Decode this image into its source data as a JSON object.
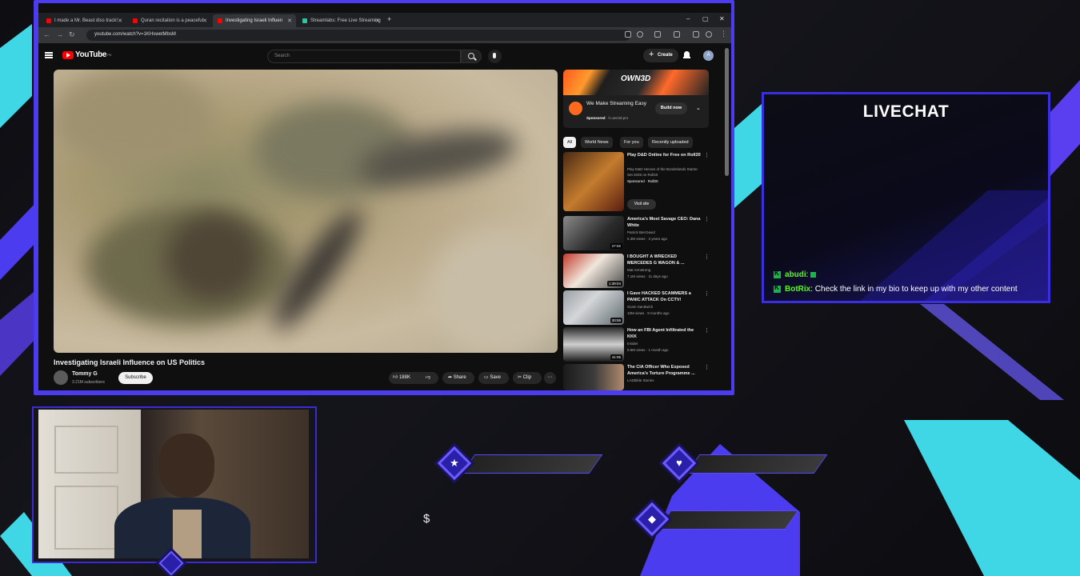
{
  "browser": {
    "tabs": [
      {
        "title": "I made a Mr. Beast diss track!",
        "favicon_color": "#ff0000"
      },
      {
        "title": "Quran recitation is a peaceful",
        "favicon_color": "#ff0000"
      },
      {
        "title": "Investigating Israeli Influen",
        "favicon_color": "#ff0000",
        "active": true
      },
      {
        "title": "Streamlabs: Free Live Streaming",
        "favicon_color": "#31c3a2"
      }
    ],
    "new_tab": "+",
    "window_controls": {
      "minimize": "–",
      "maximize": "▢",
      "close": "✕"
    },
    "nav": {
      "back": "←",
      "forward": "→",
      "reload": "↻"
    },
    "url": "youtube.com/watch?v=1KHswetMbsM"
  },
  "youtube": {
    "logo_text": "YouTube",
    "logo_country": "PK",
    "search_placeholder": "Search",
    "create_label": "Create",
    "avatar_letter": "A",
    "video": {
      "title": "Investigating Israeli Influence on US Politics",
      "channel": "Tommy G",
      "subscribers": "3.21M subscribers",
      "subscribe_label": "Subscribe",
      "likes": "188K",
      "share_label": "Share",
      "save_label": "Save",
      "clip_label": "Clip"
    },
    "ad": {
      "brand": "OWN3D",
      "title": "We Make Streaming Easy",
      "sponsored": "Sponsored",
      "domain": "h.own3d.pro",
      "cta": "Build now"
    },
    "chips": [
      "All",
      "World News",
      "For you",
      "Recently uploaded"
    ],
    "recommendations": [
      {
        "title": "Play D&D Online for Free on Roll20",
        "channel": "Play D&D Heroes of the Borderlands Starter Set 2025 on Roll20",
        "meta": "Sponsored · Roll20",
        "cta": "Visit site",
        "duration": ""
      },
      {
        "title": "America's Most Savage CEO: Dana White",
        "channel": "Patrick Bet-David",
        "meta": "5.3M views · 3 years ago",
        "duration": "27:02"
      },
      {
        "title": "I BOUGHT A WRECKED MERCEDES G WAGON & ...",
        "channel": "Mat Armstrong",
        "meta": "7.1M views · 11 days ago",
        "duration": "1:39:04"
      },
      {
        "title": "I Gave HACKED SCAMMERS a PANIC ATTACK On CCTV!",
        "channel": "Scam Sandwich",
        "meta": "10M views · 9 months ago",
        "duration": "30:59"
      },
      {
        "title": "How an FBI Agent Infiltrated the KKK",
        "channel": "Insider",
        "meta": "9.8M views · 1 month ago",
        "duration": "41:05"
      },
      {
        "title": "The CIA Officer Who Exposed America's Torture Programme ...",
        "channel": "LADbible Stories",
        "meta": "",
        "duration": ""
      }
    ]
  },
  "livechat": {
    "title": "LIVECHAT",
    "messages": [
      {
        "user": "abudi",
        "text": ""
      },
      {
        "user": "BotRix",
        "text": "Check the link in my bio to keep up with my other content"
      }
    ]
  },
  "overlay": {
    "star_icon": "★",
    "heart_icon": "♥",
    "diamond_icon": "◆",
    "dollar_sign": "$"
  },
  "colors": {
    "accent": "#4b3cf0",
    "cyan": "#3fd6e6",
    "youtube_red": "#ff0000",
    "kick_green": "#53fc18"
  }
}
